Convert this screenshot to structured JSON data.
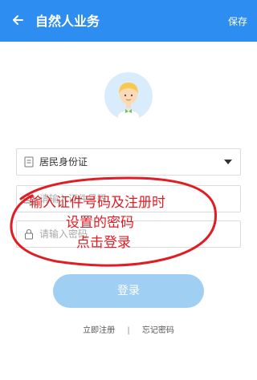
{
  "header": {
    "title": "自然人业务",
    "save_label": "保存",
    "background": "#2e8df0"
  },
  "form": {
    "id_type": {
      "value": "居民身份证",
      "icon": "id-card-icon"
    },
    "id_number": {
      "placeholder": "请输入证件号码",
      "icon": "id-card-icon"
    },
    "password": {
      "placeholder": "请输入密码",
      "icon": "lock-icon"
    },
    "login_label": "登录",
    "login_color": "#9fd0f3"
  },
  "links": {
    "register": "立即注册",
    "separator": "|",
    "forgot": "忘记密码"
  },
  "annotation": {
    "line1": "输入证件号码及注册时",
    "line2": "设置的密码",
    "line3": "点击登录",
    "color": "#e11d24"
  }
}
